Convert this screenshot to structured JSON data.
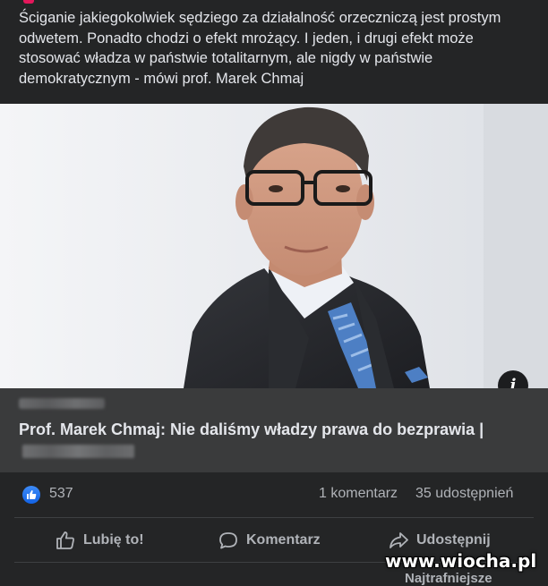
{
  "post": {
    "text": "Ściganie jakiegokolwiek sędziego za działalność orzeczniczą jest prostym odwetem. Ponadto chodzi o efekt mrożący. I jeden, i drugi efekt może stosować władza w państwie totalitarnym, ale nigdy w państwie demokratycznym - mówi prof. Marek Chmaj"
  },
  "link": {
    "title": "Prof. Marek Chmaj: Nie daliśmy władzy prawa do bezprawia |",
    "info_glyph": "i"
  },
  "stats": {
    "likes": "537",
    "comments": "1 komentarz",
    "shares": "35 udostępnień"
  },
  "actions": {
    "like": "Lubię to!",
    "comment": "Komentarz",
    "share": "Udostępnij"
  },
  "comments_sort": "Najtrafniejsze",
  "watermark": "www.wiocha.pl",
  "colors": {
    "background": "#242526",
    "link_box": "#3a3b3c",
    "like_blue": "#1877f2",
    "accent": "#e4175b"
  }
}
